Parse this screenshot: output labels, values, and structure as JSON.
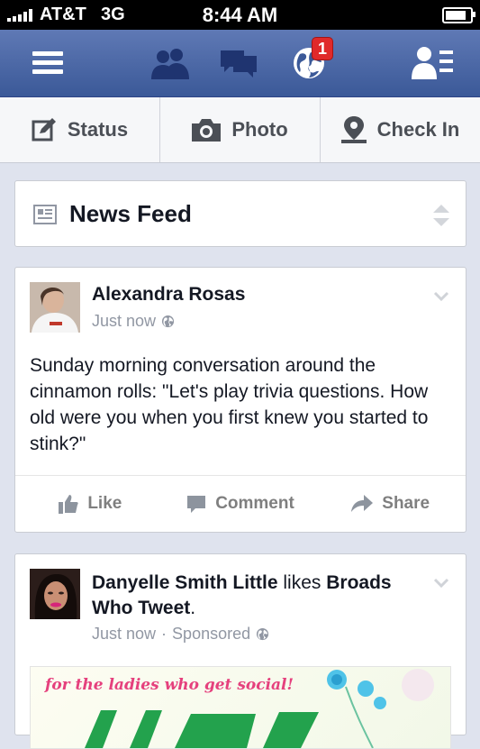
{
  "status_bar": {
    "carrier": "AT&T",
    "network": "3G",
    "time": "8:44 AM",
    "battery_level": 0.85
  },
  "nav": {
    "menu_icon": "menu-icon",
    "friends_icon": "friend-requests-icon",
    "messages_icon": "messages-icon",
    "notifications_icon": "notifications-globe-icon",
    "notifications_badge": "1",
    "contacts_icon": "contacts-icon"
  },
  "composer": {
    "status_label": "Status",
    "photo_label": "Photo",
    "checkin_label": "Check In"
  },
  "feed_header": {
    "title": "News Feed"
  },
  "posts": [
    {
      "author": "Alexandra Rosas",
      "time": "Just now",
      "privacy_icon": "globe-icon",
      "text": "Sunday morning conversation around the cinnamon rolls: \"Let's play trivia questions. How old were you when you first knew you started to stink?\"",
      "actions": {
        "like": "Like",
        "comment": "Comment",
        "share": "Share"
      }
    },
    {
      "author": "Danyelle Smith Little",
      "verb": "likes",
      "page": "Broads Who Tweet",
      "time": "Just now",
      "sponsored": "Sponsored",
      "ad_tagline": "for the ladies who get social!"
    }
  ],
  "colors": {
    "brand": "#3b5998",
    "badge": "#e0292a",
    "feed_bg": "#dfe3ee"
  }
}
